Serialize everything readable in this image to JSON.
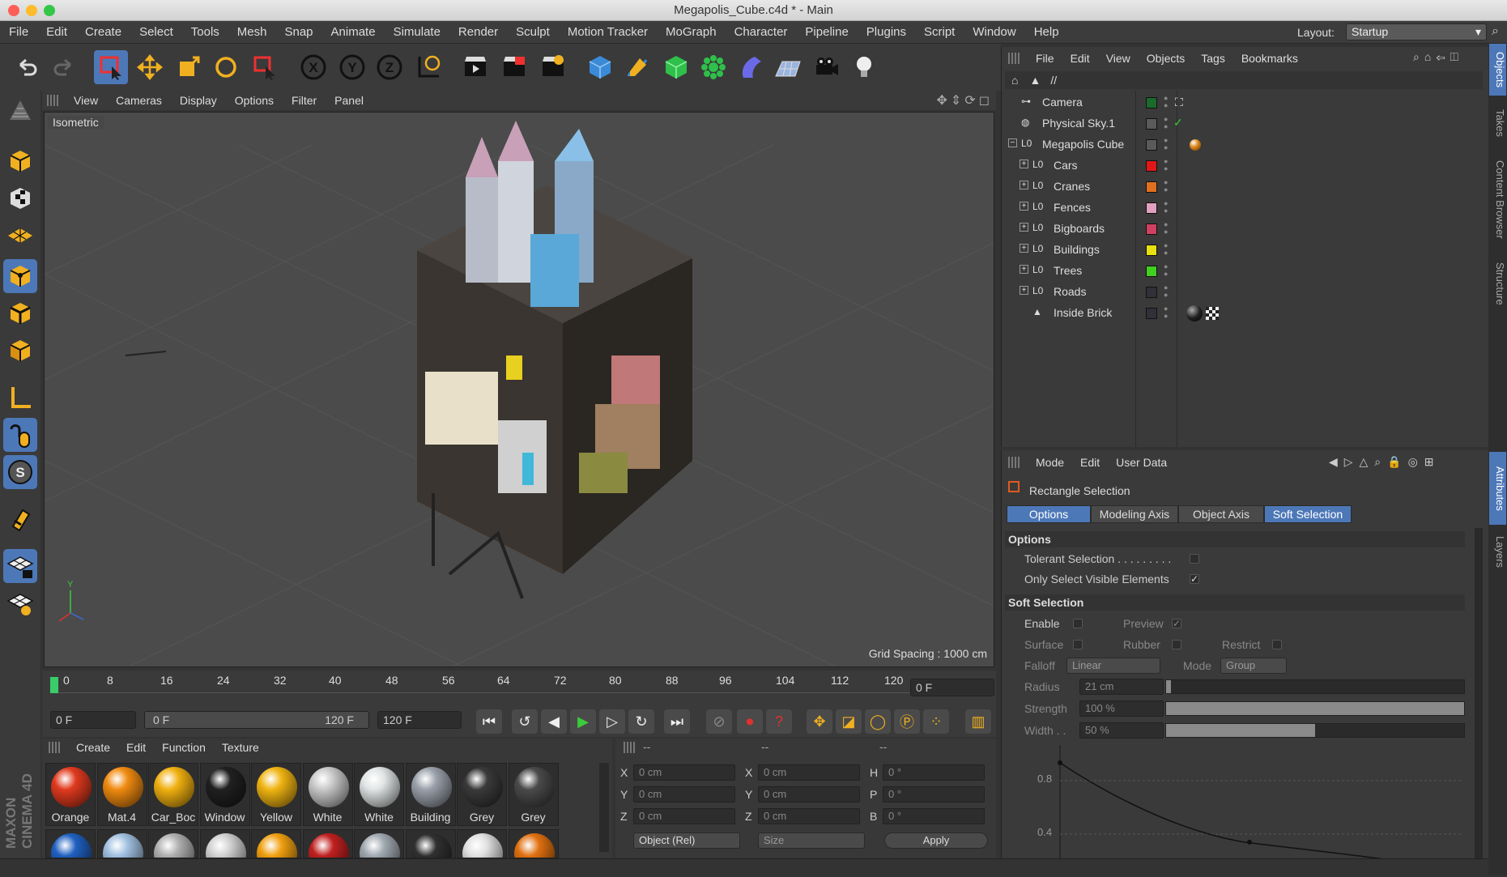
{
  "window": {
    "title": "Megapolis_Cube.c4d * - Main"
  },
  "menubar": {
    "items": [
      "File",
      "Edit",
      "Create",
      "Select",
      "Tools",
      "Mesh",
      "Snap",
      "Animate",
      "Simulate",
      "Render",
      "Sculpt",
      "Motion Tracker",
      "MoGraph",
      "Character",
      "Pipeline",
      "Plugins",
      "Script",
      "Window",
      "Help"
    ],
    "layout_label": "Layout:",
    "layout_value": "Startup"
  },
  "toolbar": {
    "icons": [
      "undo-icon",
      "redo-icon",
      "rectangle-selection-icon",
      "move-icon",
      "scale-icon",
      "rotate-icon",
      "live-selection-icon",
      "x-axis-icon",
      "y-axis-icon",
      "z-axis-icon",
      "world-coordinates-icon",
      "render-view-icon",
      "render-picture-viewer-icon",
      "edit-render-settings-icon",
      "cube-icon",
      "pen-icon",
      "subdivision-surface-icon",
      "cloner-icon",
      "deformer-icon",
      "floor-icon",
      "camera-icon",
      "light-icon"
    ]
  },
  "viewport": {
    "menu": [
      "View",
      "Cameras",
      "Display",
      "Options",
      "Filter",
      "Panel"
    ],
    "label": "Isometric",
    "grid_spacing": "Grid Spacing : 1000 cm"
  },
  "timeline": {
    "ticks": [
      "0",
      "8",
      "16",
      "24",
      "32",
      "40",
      "48",
      "56",
      "64",
      "72",
      "80",
      "88",
      "96",
      "104",
      "112",
      "120"
    ],
    "current_frame": "0 F",
    "start_frame": "0 F",
    "range_start": "0 F",
    "range_end": "120 F",
    "end_frame": "120 F"
  },
  "materials": {
    "menu": [
      "Create",
      "Edit",
      "Function",
      "Texture"
    ],
    "items": [
      {
        "name": "Orange",
        "color": "#e03a1e"
      },
      {
        "name": "Mat.4",
        "color": "#f08a10"
      },
      {
        "name": "Car_Boc",
        "color": "#f0b010"
      },
      {
        "name": "Window",
        "color": "#202020"
      },
      {
        "name": "Yellow",
        "color": "#f0b412"
      },
      {
        "name": "White",
        "color": "#c8c8c8"
      },
      {
        "name": "White",
        "color": "#e0e4e4"
      },
      {
        "name": "Building",
        "color": "#9aa0aa"
      },
      {
        "name": "Grey",
        "color": "#3a3a3a"
      },
      {
        "name": "Grey",
        "color": "#4a4a4a"
      }
    ],
    "row2_colors": [
      "#2060c0",
      "#a0c0e0",
      "#b0b0b0",
      "#d0d0d0",
      "#f0a010",
      "#c02020",
      "#a0a8b0",
      "#303030",
      "#e0e0e0",
      "#e07010"
    ]
  },
  "coordinates": {
    "headers": [
      "--",
      "--",
      "--"
    ],
    "rows": [
      {
        "a": "X",
        "a_val": "0 cm",
        "b": "X",
        "b_val": "0 cm",
        "c": "H",
        "c_val": "0 °"
      },
      {
        "a": "Y",
        "a_val": "0 cm",
        "b": "Y",
        "b_val": "0 cm",
        "c": "P",
        "c_val": "0 °"
      },
      {
        "a": "Z",
        "a_val": "0 cm",
        "b": "Z",
        "b_val": "0 cm",
        "c": "B",
        "c_val": "0 °"
      }
    ],
    "mode": "Object (Rel)",
    "size": "Size",
    "apply": "Apply"
  },
  "object_manager": {
    "menu": [
      "File",
      "Edit",
      "View",
      "Objects",
      "Tags",
      "Bookmarks"
    ],
    "path": "//",
    "objects": [
      {
        "name": "Camera",
        "color": "#1a6a2a"
      },
      {
        "name": "Physical Sky.1",
        "color": "#5a5a5a"
      },
      {
        "name": "Megapolis Cube",
        "color": "#5a5a5a"
      },
      {
        "name": "Cars",
        "color": "#e01818"
      },
      {
        "name": "Cranes",
        "color": "#e07020"
      },
      {
        "name": "Fences",
        "color": "#e0a0c0"
      },
      {
        "name": "Bigboards",
        "color": "#d04060"
      },
      {
        "name": "Buildings",
        "color": "#e8e010"
      },
      {
        "name": "Trees",
        "color": "#40d020"
      },
      {
        "name": "Roads",
        "color": "#303038"
      },
      {
        "name": "Inside Brick",
        "color": "#303038"
      }
    ]
  },
  "attributes": {
    "menu": [
      "Mode",
      "Edit",
      "User Data"
    ],
    "tool_name": "Rectangle Selection",
    "tabs": [
      "Options",
      "Modeling Axis",
      "Object Axis",
      "Soft Selection"
    ],
    "options_title": "Options",
    "tolerant": "Tolerant Selection . . . . . . . . .",
    "only_visible": "Only Select Visible Elements",
    "soft_title": "Soft Selection",
    "enable": "Enable",
    "preview": "Preview",
    "surface": "Surface",
    "rubber": "Rubber",
    "restrict": "Restrict",
    "falloff": "Falloff",
    "falloff_val": "Linear",
    "mode": "Mode",
    "mode_val": "Group",
    "radius": "Radius",
    "radius_val": "21 cm",
    "strength": "Strength",
    "strength_val": "100 %",
    "strength_level": 1.0,
    "width": "Width . .",
    "width_val": "50 %",
    "width_level": 0.5,
    "graph_y1": "0.8",
    "graph_y2": "0.4"
  },
  "right_tabs": [
    "Objects",
    "Takes",
    "Content Browser",
    "Structure",
    "Attributes",
    "Layers"
  ],
  "brand": "MAXON CINEMA 4D"
}
